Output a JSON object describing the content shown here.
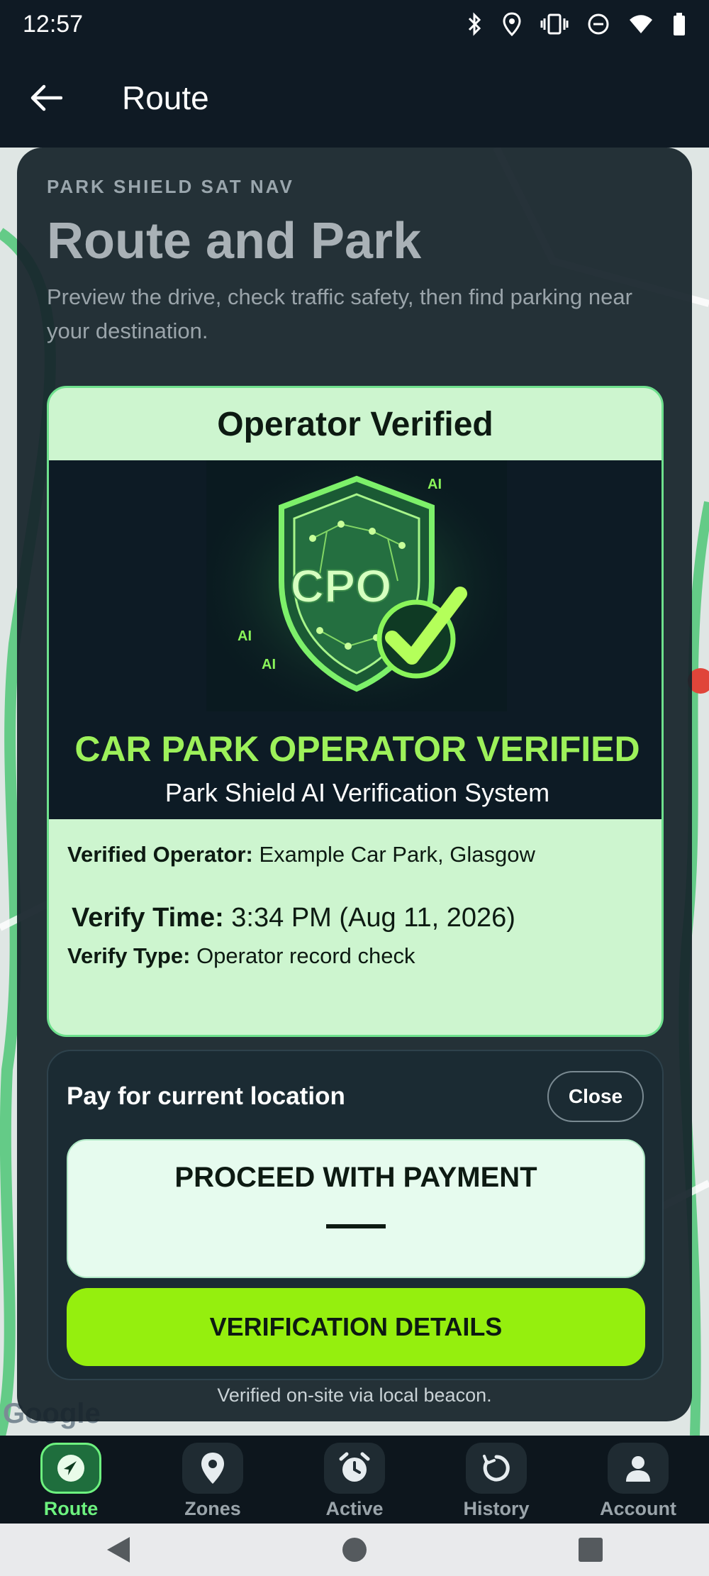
{
  "status_bar": {
    "time": "12:57"
  },
  "app_bar": {
    "title": "Route"
  },
  "map": {
    "attribution": "Google"
  },
  "card": {
    "eyebrow": "PARK SHIELD SAT NAV",
    "headline": "Route and Park",
    "subtext": "Preview the drive, check traffic safety, then find parking near your destination."
  },
  "verified": {
    "title": "Operator Verified",
    "banner": {
      "shield_text": "CPO",
      "ai_tag": "AI",
      "title": "CAR PARK OPERATOR VERIFIED",
      "subtitle": "Park Shield AI Verification System"
    },
    "operator_label": "Verified Operator:",
    "operator_value": "Example Car Park, Glasgow",
    "time_label": "Verify Time:",
    "time_value": "3:34 PM (Aug 11, 2026)",
    "type_label": "Verify Type:",
    "type_value": "Operator record check"
  },
  "payment": {
    "label": "Pay for current location",
    "close_label": "Close",
    "proceed_label": "PROCEED WITH PAYMENT",
    "details_label": "VERIFICATION DETAILS",
    "footnote": "Verified on-site via local beacon."
  },
  "bottom_nav": {
    "items": [
      {
        "label": "Route",
        "icon": "navigation-arrow-icon",
        "active": true
      },
      {
        "label": "Zones",
        "icon": "location-pin-icon",
        "active": false
      },
      {
        "label": "Active",
        "icon": "alarm-clock-icon",
        "active": false
      },
      {
        "label": "History",
        "icon": "history-icon",
        "active": false
      },
      {
        "label": "Account",
        "icon": "person-icon",
        "active": false
      }
    ]
  },
  "colors": {
    "accent_green": "#95ef0e",
    "verified_bg": "#cdf5cf",
    "nav_active": "#6df27f",
    "dark_bg": "#0f1a24"
  }
}
